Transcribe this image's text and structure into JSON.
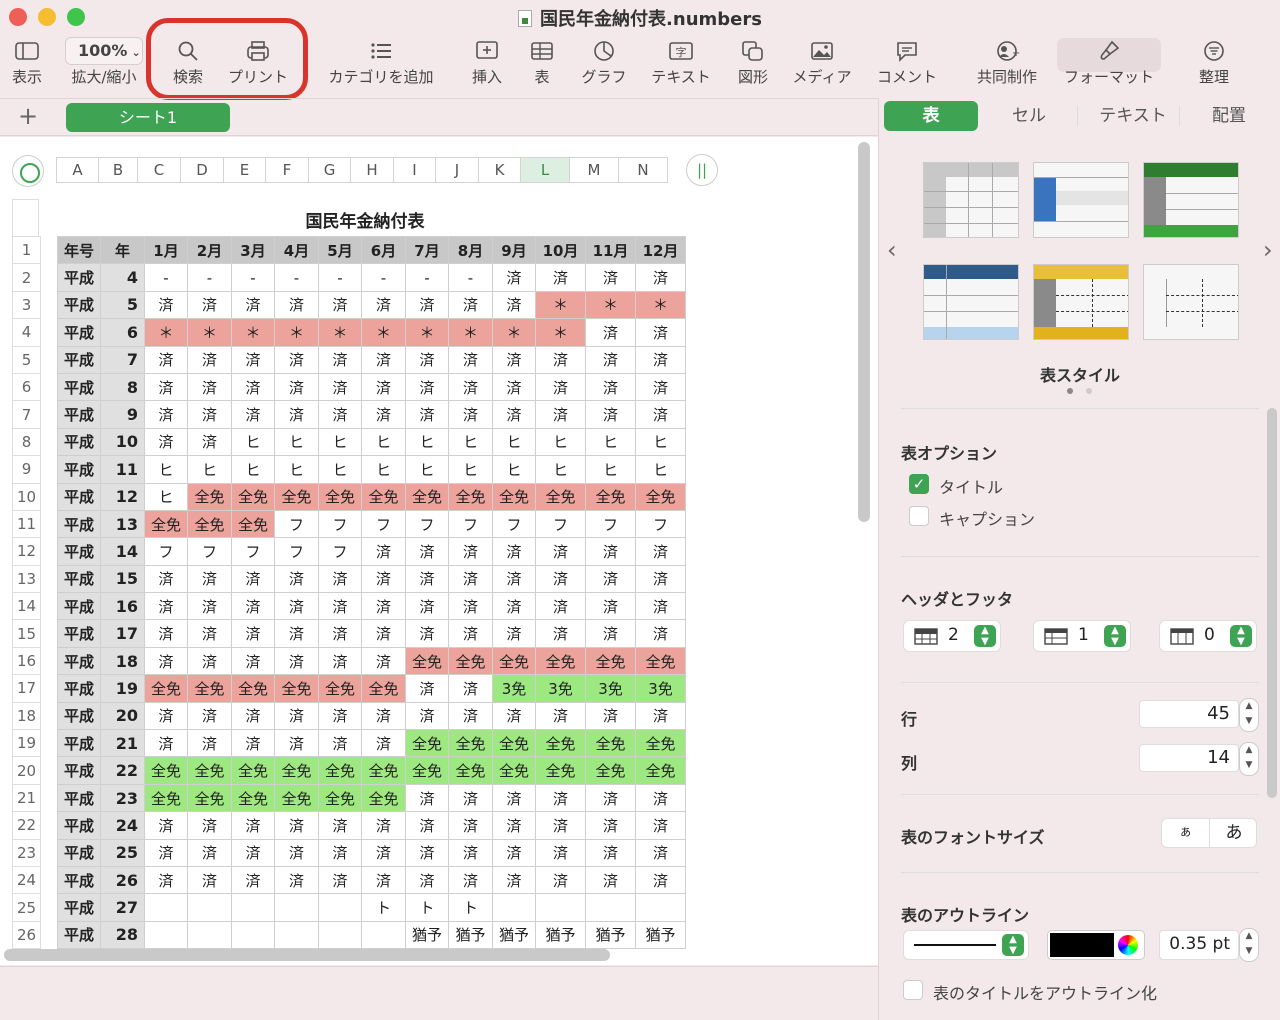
{
  "window": {
    "title": "国民年金納付表.numbers"
  },
  "toolbar": {
    "view": "表示",
    "zoom_value": "100%",
    "zoom": "拡大/縮小",
    "search": "検索",
    "print": "プリント",
    "category": "カテゴリを追加",
    "insert": "挿入",
    "table": "表",
    "chart": "グラフ",
    "text": "テキスト",
    "shape": "図形",
    "media": "メディア",
    "comment": "コメント",
    "collab": "共同制作",
    "format": "フォーマット",
    "organize": "整理"
  },
  "sheets": {
    "add": "+",
    "tabs": [
      "シート1"
    ]
  },
  "table": {
    "title": "国民年金納付表",
    "columns": [
      "A",
      "B",
      "C",
      "D",
      "E",
      "F",
      "G",
      "H",
      "I",
      "J",
      "K",
      "L",
      "M",
      "N"
    ],
    "selected_column": "L",
    "header": [
      "年号",
      "年",
      "1月",
      "2月",
      "3月",
      "4月",
      "5月",
      "6月",
      "7月",
      "8月",
      "9月",
      "10月",
      "11月",
      "12月"
    ],
    "rows": [
      [
        "平成",
        "4",
        "-",
        "-",
        "-",
        "-",
        "-",
        "-",
        "-",
        "-",
        "済",
        "済",
        "済",
        "済"
      ],
      [
        "平成",
        "5",
        "済",
        "済",
        "済",
        "済",
        "済",
        "済",
        "済",
        "済",
        "済",
        "＊",
        "＊",
        "＊"
      ],
      [
        "平成",
        "6",
        "＊",
        "＊",
        "＊",
        "＊",
        "＊",
        "＊",
        "＊",
        "＊",
        "＊",
        "＊",
        "済",
        "済"
      ],
      [
        "平成",
        "7",
        "済",
        "済",
        "済",
        "済",
        "済",
        "済",
        "済",
        "済",
        "済",
        "済",
        "済",
        "済"
      ],
      [
        "平成",
        "8",
        "済",
        "済",
        "済",
        "済",
        "済",
        "済",
        "済",
        "済",
        "済",
        "済",
        "済",
        "済"
      ],
      [
        "平成",
        "9",
        "済",
        "済",
        "済",
        "済",
        "済",
        "済",
        "済",
        "済",
        "済",
        "済",
        "済",
        "済"
      ],
      [
        "平成",
        "10",
        "済",
        "済",
        "ヒ",
        "ヒ",
        "ヒ",
        "ヒ",
        "ヒ",
        "ヒ",
        "ヒ",
        "ヒ",
        "ヒ",
        "ヒ"
      ],
      [
        "平成",
        "11",
        "ヒ",
        "ヒ",
        "ヒ",
        "ヒ",
        "ヒ",
        "ヒ",
        "ヒ",
        "ヒ",
        "ヒ",
        "ヒ",
        "ヒ",
        "ヒ"
      ],
      [
        "平成",
        "12",
        "ヒ",
        "全免",
        "全免",
        "全免",
        "全免",
        "全免",
        "全免",
        "全免",
        "全免",
        "全免",
        "全免",
        "全免"
      ],
      [
        "平成",
        "13",
        "全免",
        "全免",
        "全免",
        "フ",
        "フ",
        "フ",
        "フ",
        "フ",
        "フ",
        "フ",
        "フ",
        "フ"
      ],
      [
        "平成",
        "14",
        "フ",
        "フ",
        "フ",
        "フ",
        "フ",
        "済",
        "済",
        "済",
        "済",
        "済",
        "済",
        "済"
      ],
      [
        "平成",
        "15",
        "済",
        "済",
        "済",
        "済",
        "済",
        "済",
        "済",
        "済",
        "済",
        "済",
        "済",
        "済"
      ],
      [
        "平成",
        "16",
        "済",
        "済",
        "済",
        "済",
        "済",
        "済",
        "済",
        "済",
        "済",
        "済",
        "済",
        "済"
      ],
      [
        "平成",
        "17",
        "済",
        "済",
        "済",
        "済",
        "済",
        "済",
        "済",
        "済",
        "済",
        "済",
        "済",
        "済"
      ],
      [
        "平成",
        "18",
        "済",
        "済",
        "済",
        "済",
        "済",
        "済",
        "全免",
        "全免",
        "全免",
        "全免",
        "全免",
        "全免"
      ],
      [
        "平成",
        "19",
        "全免",
        "全免",
        "全免",
        "全免",
        "全免",
        "全免",
        "済",
        "済",
        "3免",
        "3免",
        "3免",
        "3免"
      ],
      [
        "平成",
        "20",
        "済",
        "済",
        "済",
        "済",
        "済",
        "済",
        "済",
        "済",
        "済",
        "済",
        "済",
        "済"
      ],
      [
        "平成",
        "21",
        "済",
        "済",
        "済",
        "済",
        "済",
        "済",
        "全免",
        "全免",
        "全免",
        "全免",
        "全免",
        "全免"
      ],
      [
        "平成",
        "22",
        "全免",
        "全免",
        "全免",
        "全免",
        "全免",
        "全免",
        "全免",
        "全免",
        "全免",
        "全免",
        "全免",
        "全免"
      ],
      [
        "平成",
        "23",
        "全免",
        "全免",
        "全免",
        "全免",
        "全免",
        "全免",
        "済",
        "済",
        "済",
        "済",
        "済",
        "済"
      ],
      [
        "平成",
        "24",
        "済",
        "済",
        "済",
        "済",
        "済",
        "済",
        "済",
        "済",
        "済",
        "済",
        "済",
        "済"
      ],
      [
        "平成",
        "25",
        "済",
        "済",
        "済",
        "済",
        "済",
        "済",
        "済",
        "済",
        "済",
        "済",
        "済",
        "済"
      ],
      [
        "平成",
        "26",
        "済",
        "済",
        "済",
        "済",
        "済",
        "済",
        "済",
        "済",
        "済",
        "済",
        "済",
        "済"
      ],
      [
        "平成",
        "27",
        "",
        "",
        "",
        "",
        "",
        "ト",
        "ト",
        "ト",
        "",
        "",
        "",
        ""
      ],
      [
        "平成",
        "28",
        "",
        "",
        "",
        "",
        "",
        "",
        "猶予",
        "猶予",
        "猶予",
        "猶予",
        "猶予",
        "猶予"
      ]
    ],
    "fills": [
      [
        "",
        "",
        "",
        "",
        "",
        "",
        "",
        "",
        "",
        "",
        "",
        ""
      ],
      [
        "",
        "",
        "",
        "",
        "",
        "",
        "",
        "",
        "",
        "r",
        "r",
        "r"
      ],
      [
        "r",
        "r",
        "r",
        "r",
        "r",
        "r",
        "r",
        "r",
        "r",
        "r",
        "",
        ""
      ],
      [
        "",
        "",
        "",
        "",
        "",
        "",
        "",
        "",
        "",
        "",
        "",
        ""
      ],
      [
        "",
        "",
        "",
        "",
        "",
        "",
        "",
        "",
        "",
        "",
        "",
        ""
      ],
      [
        "",
        "",
        "",
        "",
        "",
        "",
        "",
        "",
        "",
        "",
        "",
        ""
      ],
      [
        "",
        "",
        "",
        "",
        "",
        "",
        "",
        "",
        "",
        "",
        "",
        ""
      ],
      [
        "",
        "",
        "",
        "",
        "",
        "",
        "",
        "",
        "",
        "",
        "",
        ""
      ],
      [
        "",
        "r",
        "r",
        "r",
        "r",
        "r",
        "r",
        "r",
        "r",
        "r",
        "r",
        "r"
      ],
      [
        "r",
        "r",
        "r",
        "",
        "",
        "",
        "",
        "",
        "",
        "",
        "",
        ""
      ],
      [
        "",
        "",
        "",
        "",
        "",
        "",
        "",
        "",
        "",
        "",
        "",
        ""
      ],
      [
        "",
        "",
        "",
        "",
        "",
        "",
        "",
        "",
        "",
        "",
        "",
        ""
      ],
      [
        "",
        "",
        "",
        "",
        "",
        "",
        "",
        "",
        "",
        "",
        "",
        ""
      ],
      [
        "",
        "",
        "",
        "",
        "",
        "",
        "",
        "",
        "",
        "",
        "",
        ""
      ],
      [
        "",
        "",
        "",
        "",
        "",
        "",
        "r",
        "r",
        "r",
        "r",
        "r",
        "r"
      ],
      [
        "r",
        "r",
        "r",
        "r",
        "r",
        "r",
        "",
        "",
        "g",
        "g",
        "g",
        "g"
      ],
      [
        "",
        "",
        "",
        "",
        "",
        "",
        "",
        "",
        "",
        "",
        "",
        ""
      ],
      [
        "",
        "",
        "",
        "",
        "",
        "",
        "g",
        "g",
        "g",
        "g",
        "g",
        "g"
      ],
      [
        "g",
        "g",
        "g",
        "g",
        "g",
        "g",
        "g",
        "g",
        "g",
        "g",
        "g",
        "g"
      ],
      [
        "g",
        "g",
        "g",
        "g",
        "g",
        "g",
        "",
        "",
        "",
        "",
        "",
        ""
      ],
      [
        "",
        "",
        "",
        "",
        "",
        "",
        "",
        "",
        "",
        "",
        "",
        ""
      ],
      [
        "",
        "",
        "",
        "",
        "",
        "",
        "",
        "",
        "",
        "",
        "",
        ""
      ],
      [
        "",
        "",
        "",
        "",
        "",
        "",
        "",
        "",
        "",
        "",
        "",
        ""
      ],
      [
        "",
        "",
        "",
        "",
        "",
        "",
        "",
        "",
        "",
        "",
        "",
        ""
      ],
      [
        "",
        "",
        "",
        "",
        "",
        "",
        "",
        "",
        "",
        "",
        "",
        ""
      ]
    ]
  },
  "colors": {
    "red": "#eba39b",
    "green": "#9ee882",
    "accent": "#3fa354",
    "highlight": "#d9342b"
  },
  "panel": {
    "tabs": [
      "表",
      "セル",
      "テキスト",
      "配置"
    ],
    "style_label": "表スタイル",
    "options_title": "表オプション",
    "title_opt": "タイトル",
    "caption_opt": "キャプション",
    "title_checked": true,
    "caption_checked": false,
    "headers_title": "ヘッダとフッタ",
    "header_rows": "2",
    "header_cols": "1",
    "footer_rows": "0",
    "rows_label": "行",
    "rows_value": "45",
    "cols_label": "列",
    "cols_value": "14",
    "fontsize_label": "表のフォントサイズ",
    "font_small": "ぁ",
    "font_large": "あ",
    "outline_label": "表のアウトライン",
    "outline_width": "0.35 pt",
    "outline_title": "表のタイトルをアウトライン化"
  }
}
